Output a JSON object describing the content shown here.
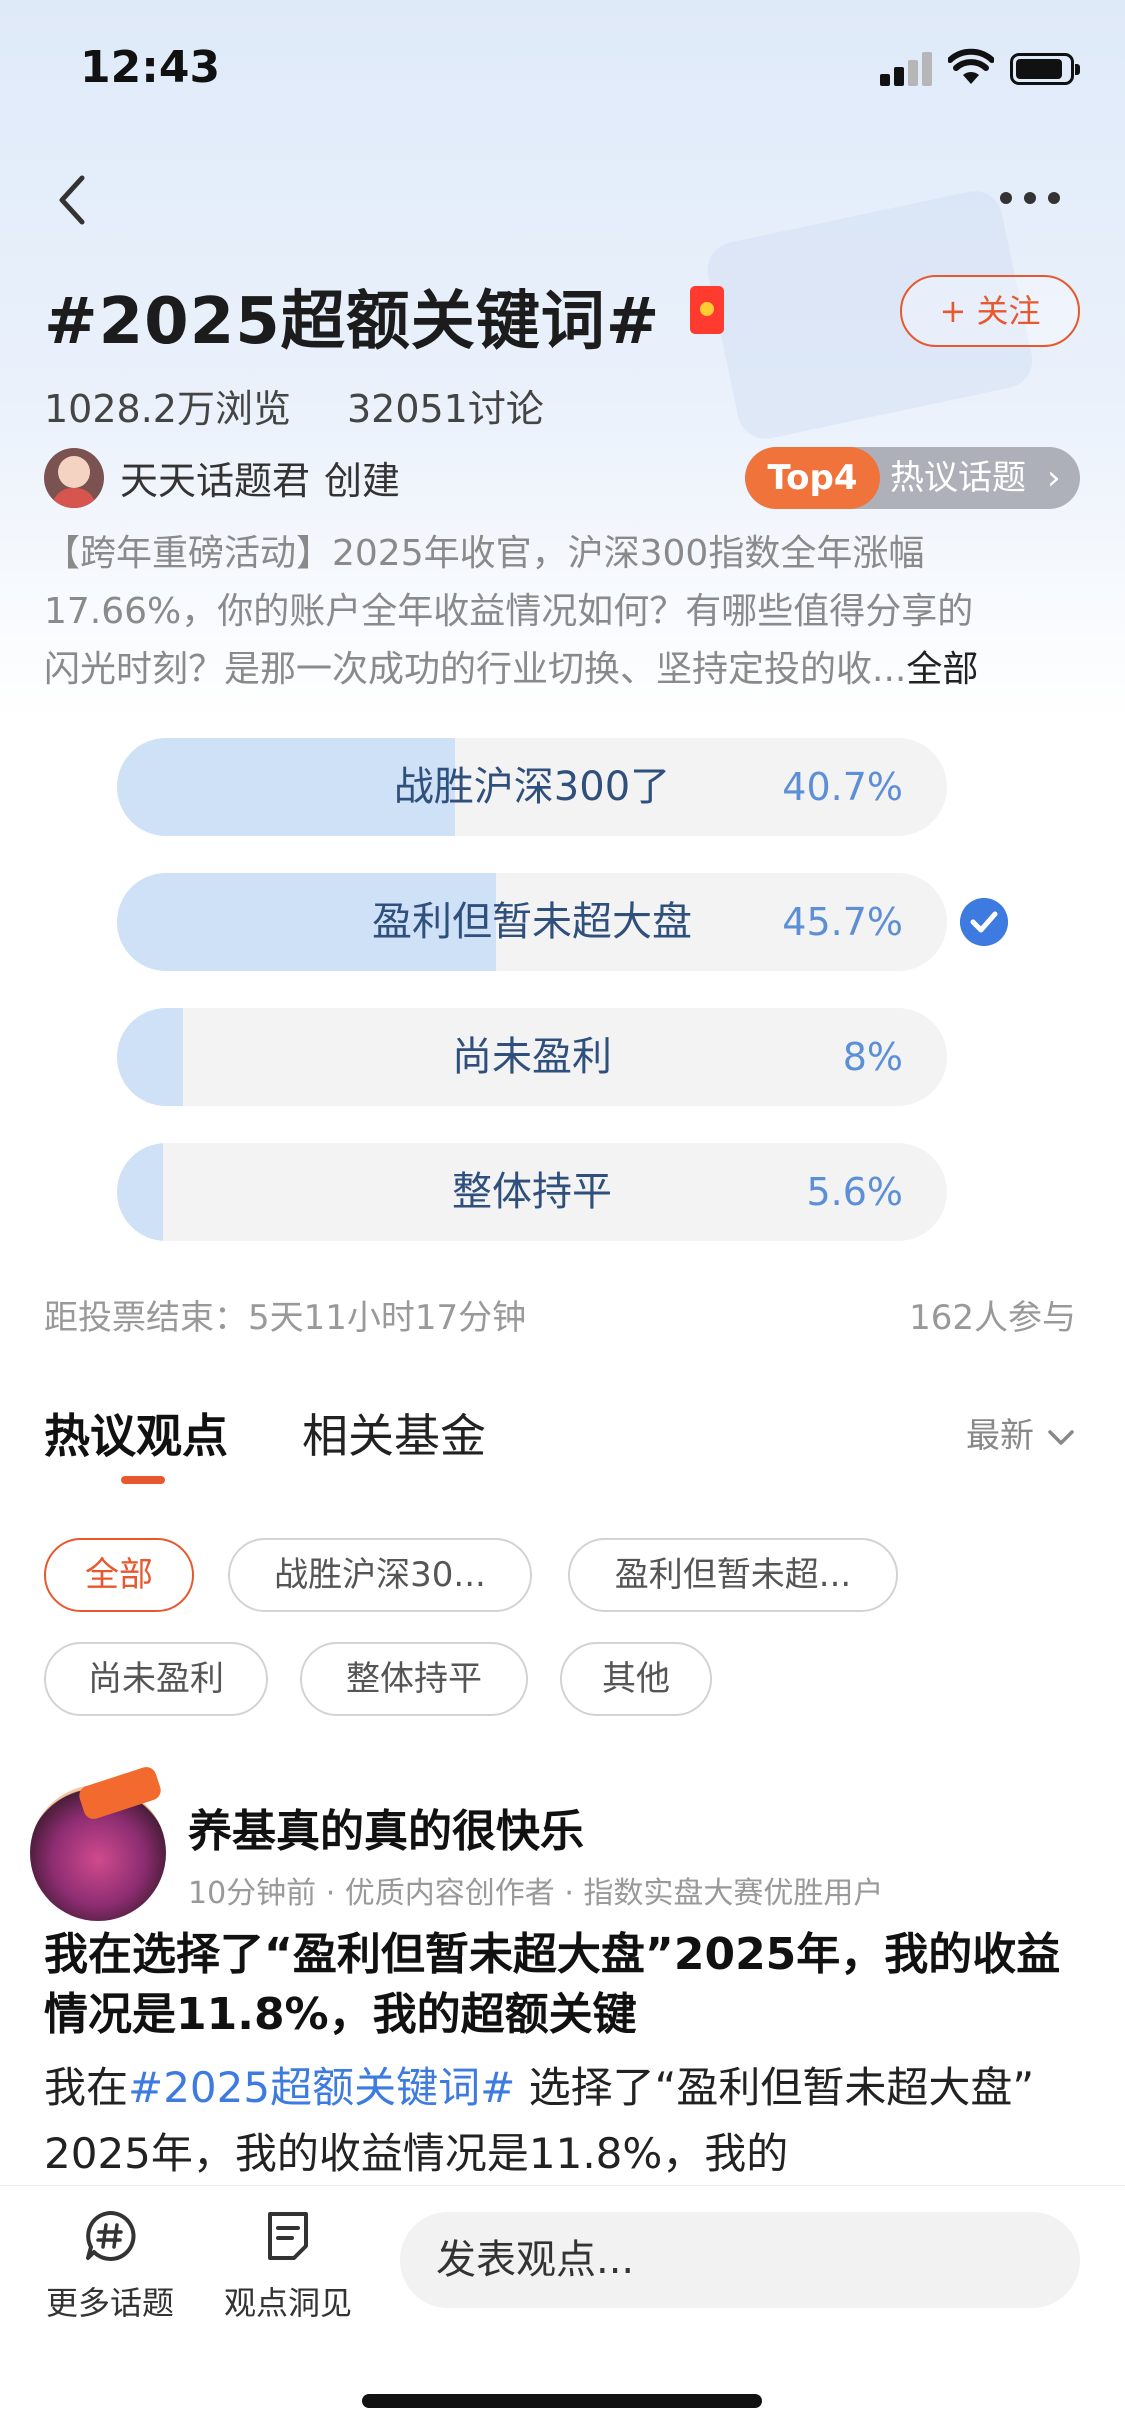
{
  "status_bar": {
    "time": "12:43"
  },
  "topic": {
    "title": "#2025超额关键词#",
    "follow_label": "+ 关注",
    "views": "1028.2万浏览",
    "discussions": "32051讨论",
    "creator_name": "天天话题君",
    "creator_suffix": "创建",
    "hot_rank": "Top4",
    "hot_label": "热议话题",
    "description_lines": [
      "【跨年重磅活动】2025年收官，沪深300指数全年涨幅",
      "17.66%，你的账户全年收益情况如何？有哪些值得分享的",
      "闪光时刻？是那一次成功的行业切换、坚持定投的收..."
    ],
    "description_more": "全部"
  },
  "poll": {
    "options": [
      {
        "label": "战胜沪深300了",
        "percent_text": "40.7%",
        "percent": 40.7,
        "selected": false
      },
      {
        "label": "盈利但暂未超大盘",
        "percent_text": "45.7%",
        "percent": 45.7,
        "selected": true
      },
      {
        "label": "尚未盈利",
        "percent_text": "8%",
        "percent": 8,
        "selected": false
      },
      {
        "label": "整体持平",
        "percent_text": "5.6%",
        "percent": 5.6,
        "selected": false
      }
    ],
    "countdown": "距投票结束：5天11小时17分钟",
    "participants": "162人参与"
  },
  "tabs": {
    "active": "热议观点",
    "second": "相关基金",
    "sort": "最新"
  },
  "filters": [
    "全部",
    "战胜沪深30...",
    "盈利但暂未超...",
    "尚未盈利",
    "整体持平",
    "其他"
  ],
  "post": {
    "author": "养基真的真的很快乐",
    "meta": [
      "10分钟前",
      "优质内容创作者",
      "指数实盘大赛优胜用户"
    ],
    "title": "我在选择了“盈利但暂未超大盘”2025年，我的收益情况是11.8%，我的超额关键",
    "body_prefix": "我在",
    "body_tag": "#2025超额关键词#",
    "body_rest": " 选择了“盈利但暂未超大盘” 2025年，我的收益情况是11.8%，我的"
  },
  "bottom_bar": {
    "more_topics": "更多话题",
    "insights": "观点洞见",
    "input_placeholder": "发表观点..."
  },
  "colors": {
    "accent": "#e8582e",
    "poll_fill": "#cfe1f7",
    "poll_text": "#2f4f7c",
    "link": "#3d7be0"
  }
}
